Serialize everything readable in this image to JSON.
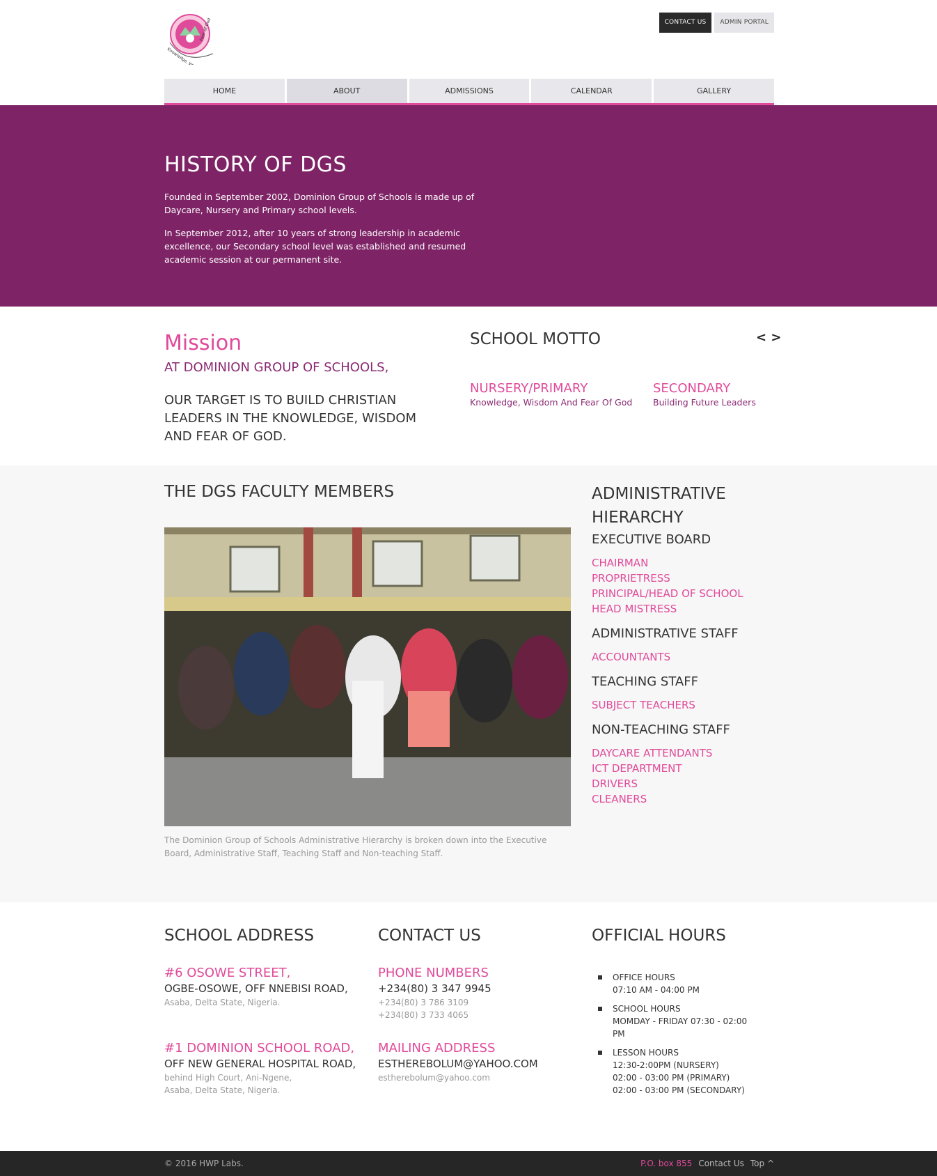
{
  "header": {
    "logo_text": "Knowledge, Wisdom and Fear of God",
    "contact_btn": "CONTACT US",
    "admin_btn": "ADMIN PORTAL"
  },
  "nav": [
    "HOME",
    "ABOUT",
    "ADMISSIONS",
    "CALENDAR",
    "GALLERY"
  ],
  "hero": {
    "title": "HISTORY OF DGS",
    "p1": "Founded in September 2002, Dominion Group of Schools is made up of Daycare, Nursery and Primary school levels.",
    "p2": "In September 2012, after 10 years of strong leadership in academic excellence, our Secondary school level was established and resumed academic session at our permanent site."
  },
  "mission": {
    "title": "Mission",
    "sub": "AT DOMINION GROUP OF SCHOOLS,",
    "body": "OUR TARGET IS TO BUILD CHRISTIAN LEADERS IN THE KNOWLEDGE, WISDOM AND FEAR OF GOD."
  },
  "motto": {
    "title": "SCHOOL MOTTO",
    "arrows": "< >",
    "cols": [
      {
        "h": "NURSERY/PRIMARY",
        "s": "Knowledge, Wisdom And Fear Of God"
      },
      {
        "h": "SECONDARY",
        "s": "Building Future Leaders"
      }
    ]
  },
  "faculty": {
    "title": "THE DGS FACULTY MEMBERS",
    "caption": "The Dominion Group of Schools Administrative Hierarchy is broken down into the Executive Board, Administrative Staff, Teaching Staff and Non-teaching Staff."
  },
  "admin": {
    "title": "ADMINISTRATIVE HIERARCHY",
    "groups": [
      {
        "name": "EXECUTIVE BOARD",
        "items": [
          "CHAIRMAN",
          "PROPRIETRESS",
          "PRINCIPAL/HEAD OF SCHOOL",
          "HEAD MISTRESS"
        ]
      },
      {
        "name": "ADMINISTRATIVE STAFF",
        "items": [
          "ACCOUNTANTS"
        ]
      },
      {
        "name": "TEACHING STAFF",
        "items": [
          "SUBJECT TEACHERS"
        ]
      },
      {
        "name": "NON-TEACHING STAFF",
        "items": [
          "DAYCARE ATTENDANTS",
          "ICT DEPARTMENT",
          "DRIVERS",
          "CLEANERS"
        ]
      }
    ]
  },
  "address": {
    "title": "SCHOOL ADDRESS",
    "a1_line1": "#6 OSOWE STREET,",
    "a1_line2": "OGBE-OSOWE, OFF NNEBISI ROAD,",
    "a1_line3": "Asaba, Delta State, Nigeria.",
    "a2_line1": "#1 DOMINION SCHOOL ROAD,",
    "a2_line2": "OFF NEW GENERAL HOSPITAL ROAD,",
    "a2_line3": "behind High Court, Ani-Ngene,",
    "a2_line4": "Asaba, Delta State, Nigeria."
  },
  "contact": {
    "title": "CONTACT US",
    "phone_h": "PHONE NUMBERS",
    "phone1": "+234(80) 3 347 9945",
    "phone2": "+234(80) 3 786 3109",
    "phone3": "+234(80) 3 733 4065",
    "mail_h": "MAILING ADDRESS",
    "mail1": "ESTHEREBOLUM@YAHOO.COM",
    "mail2": "estherebolum@yahoo.com"
  },
  "hours": {
    "title": "OFFICIAL HOURS",
    "office_h": "OFFICE HOURS",
    "office_v": "07:10 AM - 04:00 PM",
    "school_h": "SCHOOL HOURS",
    "school_v": "MOMDAY - FRIDAY 07:30 - 02:00 PM",
    "lesson_h": "LESSON HOURS",
    "lesson_1": "12:30-2:00PM (NURSERY)",
    "lesson_2": "02:00 - 03:00 PM (PRIMARY)",
    "lesson_3": "02:00 - 03:00 PM (SECONDARY)"
  },
  "footer": {
    "copy": "© 2016 HWP Labs.",
    "pobox": "P.O. box 855",
    "contact": "Contact Us",
    "top": "Top ^"
  },
  "colors": {
    "accent": "#e04a9a",
    "hero_bg": "#7e2466",
    "dark": "#262626"
  }
}
